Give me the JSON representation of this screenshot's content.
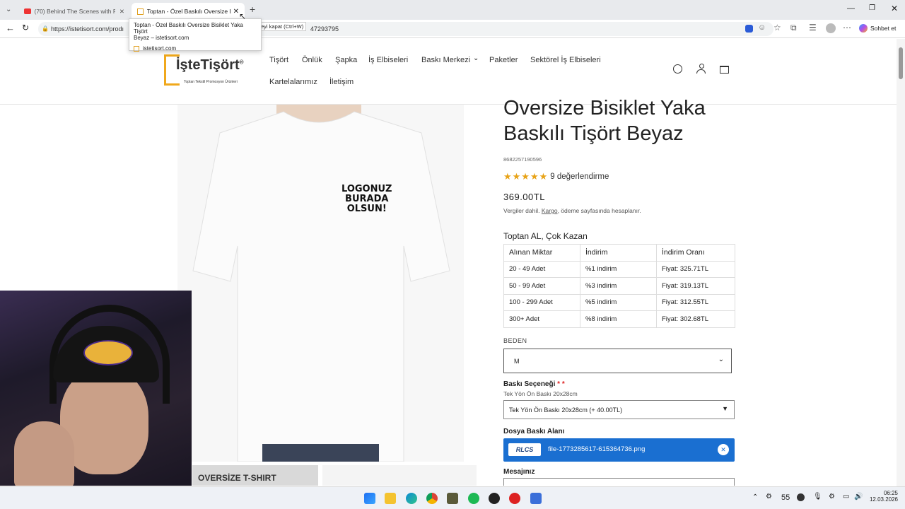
{
  "browser": {
    "tabs": [
      {
        "label": "(70) Behind The Scenes with Pros"
      },
      {
        "label": "Toptan - Özel Baskılı Oversize Bisik"
      }
    ],
    "url": "https://istetisort.com/prodı",
    "url_tail": "47293795",
    "tooltip": {
      "line1": "Toptan - Özel Baskılı Oversize Bisiklet Yaka Tişört",
      "line2": "Beyaz – istetisort.com",
      "site": "istetisort.com"
    },
    "close_hint": "eyi kapat (Ctrl+W)",
    "profile_label": "Sohbet et"
  },
  "site": {
    "logo_main": "İşteTişört",
    "logo_sub": "Toptan Tekstil Promosyon Ürünleri",
    "nav": [
      "Tişört",
      "Önlük",
      "Şapka",
      "İş Elbiseleri",
      "Baskı Merkezi",
      "Paketler",
      "Sektörel İş Elbiseleri",
      "Kartelalarımız",
      "İletişim"
    ]
  },
  "product": {
    "title_line1": "Oversize Bisiklet Yaka",
    "title_line2": "Baskılı Tişört Beyaz",
    "sku": "8682257190596",
    "rating_text": "9 değerlendirme",
    "rating_value": 5,
    "price": "369.00TL",
    "tax_note_pre": "Vergiler dahil. ",
    "tax_note_link": "Kargo",
    "tax_note_post": ", ödeme sayfasında hesaplanır.",
    "shirt_text": [
      "LOGONUZ",
      "BURADA",
      "OLSUN!"
    ],
    "thumb_text": "OVERSİZE T-SHIRT",
    "wholesale_title": "Toptan AL, Çok Kazan",
    "wholesale_headers": [
      "Alınan Miktar",
      "İndirim",
      "İndirim Oranı"
    ],
    "wholesale_rows": [
      [
        "20 - 49 Adet",
        "%1 indirim",
        "Fiyat: 325.71TL"
      ],
      [
        "50 - 99 Adet",
        "%3 indirim",
        "Fiyat: 319.13TL"
      ],
      [
        "100 - 299 Adet",
        "%5 indirim",
        "Fiyat: 312.55TL"
      ],
      [
        "300+ Adet",
        "%8 indirim",
        "Fiyat: 302.68TL"
      ]
    ],
    "size_label": "BEDEN",
    "size_value": "M",
    "print_label": "Baskı Seçeneği",
    "print_required": "* *",
    "print_sub": "Tek Yön Ön Baskı 20x28cm",
    "print_value": "Tek Yön Ön Baskı 20x28cm (+ 40.00TL)",
    "file_label": "Dosya Baskı Alanı",
    "file_badge": "RLCS",
    "file_name": "file-1773285617-615364736.png",
    "message_label": "Mesajınız"
  },
  "taskbar": {
    "temp": "55",
    "time": "06:25",
    "date": "12.03.2026"
  },
  "colors": {
    "accent_blue": "#1a6fd1",
    "star": "#e8a317",
    "logo_yellow": "#f0a81c"
  }
}
